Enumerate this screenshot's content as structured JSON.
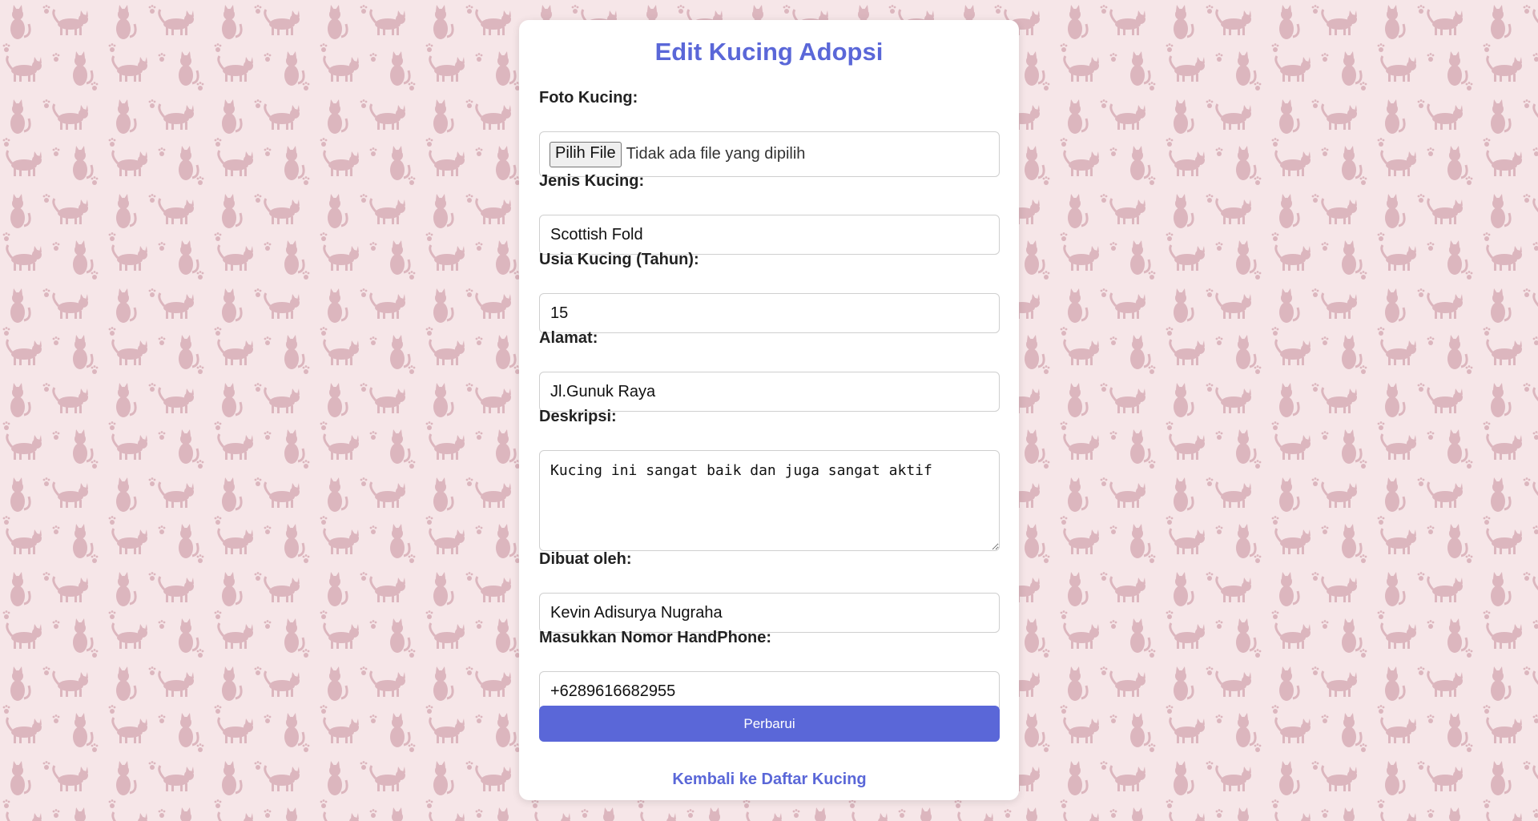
{
  "page": {
    "title": "Edit Kucing Adopsi",
    "background_color": "#f6e6e8",
    "pattern_color": "#dcb6be",
    "accent_color": "#5a67d8"
  },
  "form": {
    "photo": {
      "label": "Foto Kucing:",
      "button_label": "Pilih File",
      "status_text": "Tidak ada file yang dipilih"
    },
    "breed": {
      "label": "Jenis Kucing:",
      "value": "Scottish Fold"
    },
    "age": {
      "label": "Usia Kucing (Tahun):",
      "value": "15"
    },
    "address": {
      "label": "Alamat:",
      "value": "Jl.Gunuk Raya"
    },
    "description": {
      "label": "Deskripsi:",
      "value": "Kucing ini sangat baik dan juga sangat aktif"
    },
    "created_by": {
      "label": "Dibuat oleh:",
      "value": "Kevin Adisurya Nugraha"
    },
    "phone": {
      "label": "Masukkan Nomor HandPhone:",
      "value": "+6289616682955"
    },
    "submit_label": "Perbarui",
    "back_link_label": "Kembali ke Daftar Kucing"
  }
}
